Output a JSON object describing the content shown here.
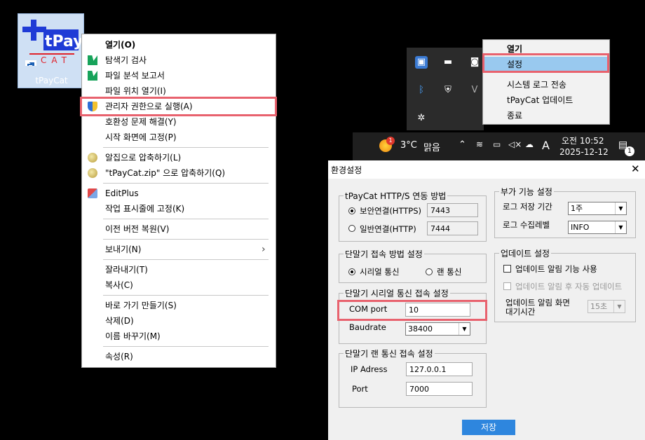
{
  "desktop": {
    "icon_label": "tPayCat",
    "logo_text_top": "tPay",
    "logo_text_bottom": "CAT"
  },
  "context_menu": {
    "items": [
      {
        "label": "열기(O)",
        "bold": true
      },
      {
        "label": "탐색기 검사",
        "icon": "scan-icon"
      },
      {
        "label": "파일 분석 보고서",
        "icon": "report-icon"
      },
      {
        "label": "파일 위치 열기(I)"
      },
      {
        "label": "관리자 권한으로 실행(A)",
        "icon": "shield-icon"
      },
      {
        "label": "호환성 문제 해결(Y)"
      },
      {
        "label": "시작 화면에 고정(P)"
      },
      {
        "label": "알집으로 압축하기(L)",
        "icon": "alzip-icon"
      },
      {
        "label": "\"tPayCat.zip\" 으로 압축하기(Q)",
        "icon": "alzip-icon"
      },
      {
        "label": "EditPlus",
        "icon": "editplus-icon"
      },
      {
        "label": "작업 표시줄에 고정(K)"
      },
      {
        "label": "이전 버전 복원(V)"
      },
      {
        "label": "보내기(N)"
      },
      {
        "label": "잘라내기(T)"
      },
      {
        "label": "복사(C)"
      },
      {
        "label": "바로 가기 만들기(S)"
      },
      {
        "label": "삭제(D)"
      },
      {
        "label": "이름 바꾸기(M)"
      },
      {
        "label": "속성(R)"
      }
    ]
  },
  "tray_menu": {
    "items": [
      "열기",
      "설정",
      "시스템 로그 전송",
      "tPayCat 업데이트",
      "종료"
    ]
  },
  "taskbar": {
    "weather_badge": "1",
    "temperature": "3°C",
    "weather": "맑음",
    "ime": "A",
    "time": "오전 10:52",
    "date": "2025-12-12",
    "notification_count": "1"
  },
  "dialog": {
    "title": "환경설정",
    "close": "✕",
    "connection": {
      "title": "tPayCat HTTP/S 연동 방법",
      "secure_label": "보안연결(HTTPS)",
      "secure_port": "7443",
      "plain_label": "일반연결(HTTP)",
      "plain_port": "7444"
    },
    "terminal_method": {
      "title": "단말기 접속 방법 설정",
      "serial_label": "시리얼 통신",
      "lan_label": "랜 통신"
    },
    "serial": {
      "title": "단말기 시리얼 통신 접속 설정",
      "com_label": "COM port",
      "com_value": "10",
      "baud_label": "Baudrate",
      "baud_value": "38400"
    },
    "lan": {
      "title": "단말기 랜 통신 접속 설정",
      "ip_label": "IP Adress",
      "ip_value": "127.0.0.1",
      "port_label": "Port",
      "port_value": "7000"
    },
    "extra": {
      "title": "부가 기능 설정",
      "log_period_label": "로그 저장 기간",
      "log_period_value": "1주",
      "log_level_label": "로그 수집레벨",
      "log_level_value": "INFO"
    },
    "update": {
      "title": "업데이트 설정",
      "alert_label": "업데이트 알림 기능 사용",
      "auto_label": "업데이트 알림 후 자동 업데이트",
      "wait_label_1": "업데이트 알림 화면",
      "wait_label_2": "대기시간",
      "wait_value": "15초"
    },
    "save_label": "저장"
  },
  "colors": {
    "highlight": "#e8626e",
    "menu_selected": "#99c9ef",
    "save_button": "#2e86de"
  }
}
